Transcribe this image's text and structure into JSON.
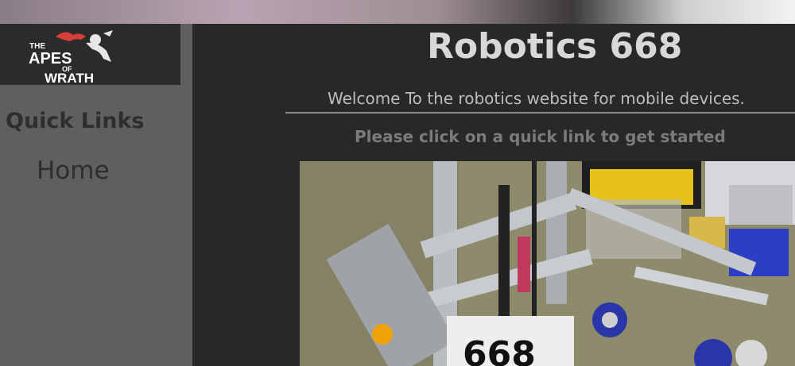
{
  "header": {
    "logo_text": [
      "THE",
      "APES",
      "OF",
      "WRATH"
    ]
  },
  "sidebar": {
    "section_title": "Quick Links",
    "items": [
      {
        "label": "Home"
      }
    ]
  },
  "main": {
    "title": "Robotics 668",
    "welcome": "Welcome To the robotics website for mobile devices.",
    "prompt": "Please click on a quick link to get started",
    "photo_robot_number": "668"
  },
  "colors": {
    "sidebar_bg": "#5f5f5f",
    "main_bg": "#282828",
    "title_color": "#d8d8d8"
  }
}
